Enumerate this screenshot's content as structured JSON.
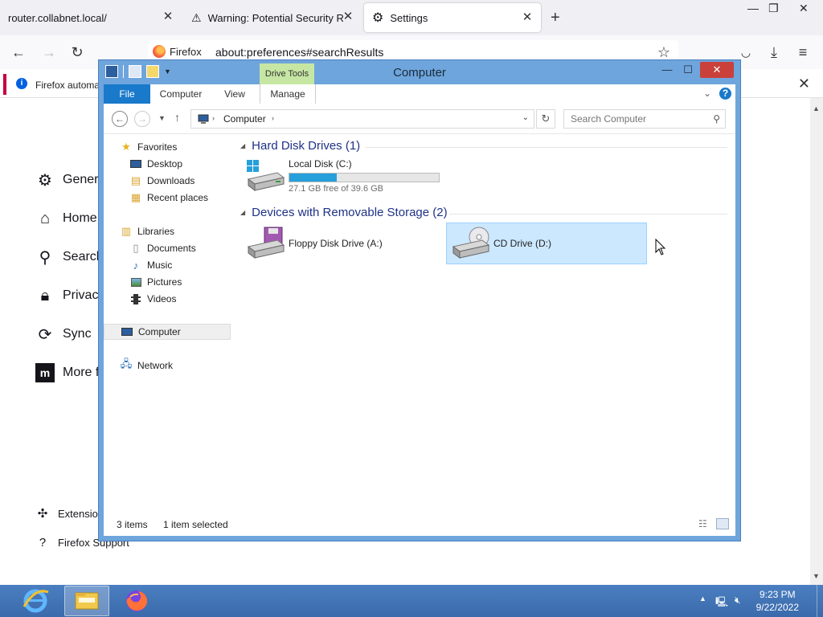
{
  "firefox": {
    "tabs": [
      {
        "label": "router.collabnet.local/"
      },
      {
        "label": "Warning: Potential Security Risk"
      },
      {
        "label": "Settings"
      }
    ],
    "url_identity": "Firefox",
    "url": "about:preferences#searchResults",
    "notice_text": "Firefox automa",
    "sidebar": [
      {
        "label": "Genera"
      },
      {
        "label": "Home"
      },
      {
        "label": "Search"
      },
      {
        "label": "Privacy"
      },
      {
        "label": "Sync"
      },
      {
        "label": "More f"
      },
      {
        "label": "Extensio"
      },
      {
        "label": "Firefox Support"
      }
    ]
  },
  "explorer": {
    "title": "Computer",
    "context_tab": "Drive Tools",
    "ribbon_tabs": [
      "File",
      "Computer",
      "View",
      "Manage"
    ],
    "address_crumb": "Computer",
    "search_placeholder": "Search Computer",
    "nav": {
      "favorites": "Favorites",
      "desktop": "Desktop",
      "downloads": "Downloads",
      "recent": "Recent places",
      "libraries": "Libraries",
      "documents": "Documents",
      "music": "Music",
      "pictures": "Pictures",
      "videos": "Videos",
      "computer": "Computer",
      "network": "Network"
    },
    "groups": {
      "hard_disks": "Hard Disk Drives (1)",
      "removable": "Devices with Removable Storage (2)"
    },
    "drives": {
      "c_name": "Local Disk (C:)",
      "c_free": "27.1 GB free of 39.6 GB",
      "c_used_fraction": 0.316,
      "a_name": "Floppy Disk Drive (A:)",
      "d_name": "CD Drive (D:)"
    },
    "status": {
      "items": "3 items",
      "selected": "1 item selected"
    }
  },
  "taskbar": {
    "time": "9:23 PM",
    "date": "9/22/2022"
  },
  "colors": {
    "file_tab": "#1979ca",
    "drive_tools": "#c6e6a3",
    "selection": "#cce8ff",
    "capacity": "#26a0da",
    "group_header": "#1e3287"
  }
}
